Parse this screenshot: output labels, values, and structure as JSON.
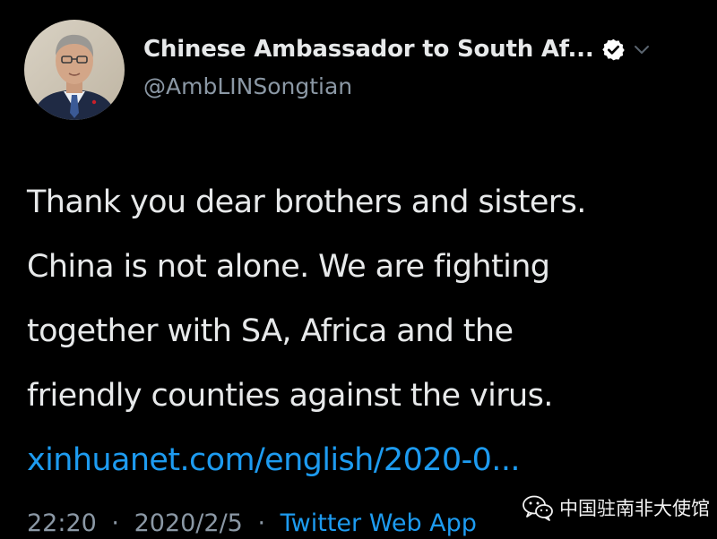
{
  "tweet": {
    "author": {
      "display_name": "Chinese Ambassador to South Af...",
      "handle": "@AmbLINSongtian",
      "verified_icon": "verified-badge-icon",
      "menu_icon": "chevron-down-icon"
    },
    "body_lines": [
      "Thank you dear brothers and sisters.",
      "China is not alone. We are fighting",
      "together with SA, Africa and the",
      "friendly counties against the virus."
    ],
    "link": "xinhuanet.com/english/2020-0...",
    "time": "22:20",
    "separator": "·",
    "date": "2020/2/5",
    "source_app": "Twitter Web App"
  },
  "watermark": {
    "text": "中国驻南非大使馆",
    "icon": "wechat-icon"
  },
  "colors": {
    "background": "#000000",
    "primary_text": "#e7e9ea",
    "secondary_text": "#8b98a5",
    "link": "#1d9bf0"
  }
}
